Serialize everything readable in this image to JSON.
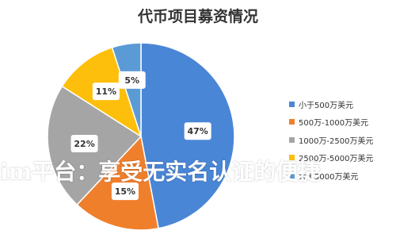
{
  "chart_data": {
    "type": "pie",
    "title": "代币项目募资情况",
    "categories": [
      "小于500万美元",
      "500万-1000万美元",
      "1000万-2500万美元",
      "2500万-5000万美元",
      "大于5000万美元"
    ],
    "values": [
      47,
      15,
      22,
      11,
      5
    ],
    "data_labels": [
      "47%",
      "15%",
      "22%",
      "11%",
      "5%"
    ],
    "colors": [
      "#4a86d6",
      "#f07f2c",
      "#a5a5a5",
      "#fdbf0b",
      "#5b9bd5"
    ],
    "legend_position": "right"
  },
  "overlay": {
    "text": "im平台：享受无实名认证的便捷"
  }
}
